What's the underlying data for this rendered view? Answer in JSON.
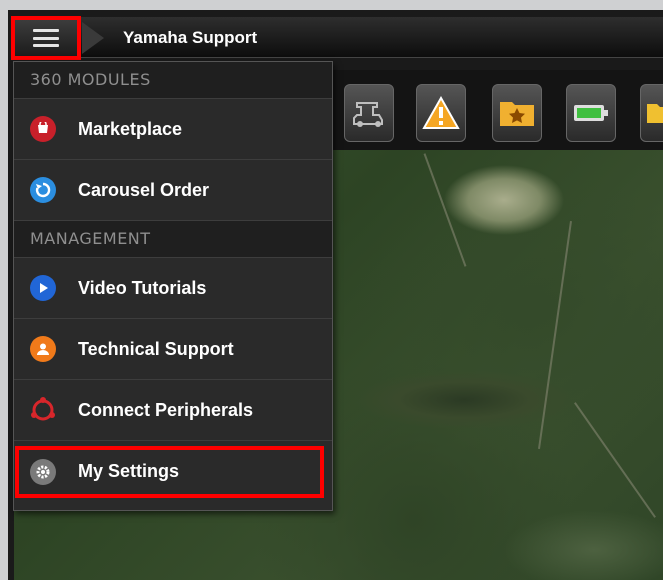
{
  "header": {
    "title": "Yamaha Support",
    "menu_icon": "hamburger-icon"
  },
  "menu": {
    "sections": [
      {
        "label": "360 MODULES",
        "items": [
          {
            "label": "Marketplace",
            "icon": "marketplace-icon",
            "color": "#c8202a"
          },
          {
            "label": "Carousel Order",
            "icon": "carousel-order-icon",
            "color": "#2b8ee0"
          }
        ]
      },
      {
        "label": "MANAGEMENT",
        "items": [
          {
            "label": "Video Tutorials",
            "icon": "play-icon",
            "color": "#2166d6"
          },
          {
            "label": "Technical Support",
            "icon": "support-person-icon",
            "color": "#f07a1a"
          },
          {
            "label": "Connect Peripherals",
            "icon": "peripherals-icon",
            "color": "#d8262b"
          },
          {
            "label": "My Settings",
            "icon": "gear-icon",
            "color": "#7a7a7a"
          }
        ]
      }
    ]
  },
  "toolbar": {
    "buttons": [
      {
        "icon": "golf-cart-icon"
      },
      {
        "icon": "warning-icon",
        "color": "#f5a623"
      },
      {
        "icon": "folder-star-icon",
        "color": "#f0b030"
      },
      {
        "icon": "battery-icon",
        "color": "#3fbf3f"
      },
      {
        "icon": "folder-icon",
        "color": "#f0c030"
      }
    ]
  },
  "highlights": {
    "color": "#ff0000"
  }
}
